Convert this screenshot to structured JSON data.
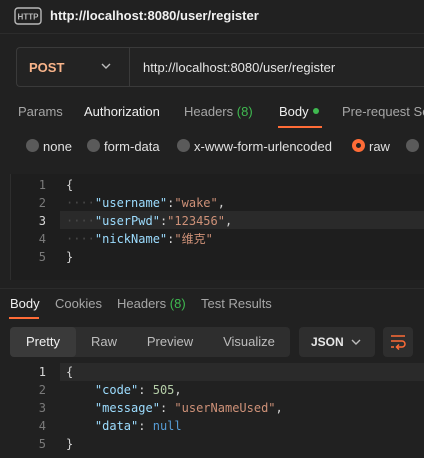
{
  "window": {
    "title": "http://localhost:8080/user/register",
    "icon": "http-icon"
  },
  "request": {
    "method": "POST",
    "url": "http://localhost:8080/user/register"
  },
  "request_tabs": [
    {
      "label": "Params"
    },
    {
      "label": "Authorization"
    },
    {
      "label": "Headers",
      "count": "(8)"
    },
    {
      "label": "Body",
      "active": true
    },
    {
      "label": "Pre-request Sc"
    }
  ],
  "body_types": [
    {
      "label": "none"
    },
    {
      "label": "form-data"
    },
    {
      "label": "x-www-form-urlencoded"
    },
    {
      "label": "raw",
      "selected": true
    }
  ],
  "request_body": {
    "line_numbers": [
      "1",
      "2",
      "3",
      "4",
      "5"
    ],
    "lines": [
      {
        "tokens": [
          {
            "t": "{",
            "c": "punc"
          }
        ]
      },
      {
        "tokens": [
          {
            "t": "\"username\"",
            "c": "key"
          },
          {
            "t": ":",
            "c": "punc"
          },
          {
            "t": "\"wake\"",
            "c": "str"
          },
          {
            "t": ",",
            "c": "punc"
          }
        ]
      },
      {
        "tokens": [
          {
            "t": "\"userPwd\"",
            "c": "key"
          },
          {
            "t": ":",
            "c": "punc"
          },
          {
            "t": "\"123456\"",
            "c": "str"
          },
          {
            "t": ",",
            "c": "punc"
          }
        ]
      },
      {
        "tokens": [
          {
            "t": "\"nickName\"",
            "c": "key"
          },
          {
            "t": ":",
            "c": "punc"
          },
          {
            "t": "\"维克\"",
            "c": "str"
          }
        ]
      },
      {
        "tokens": [
          {
            "t": "}",
            "c": "punc"
          }
        ]
      }
    ]
  },
  "response_tabs": [
    {
      "label": "Body",
      "active": true
    },
    {
      "label": "Cookies"
    },
    {
      "label": "Headers",
      "count": "(8)"
    },
    {
      "label": "Test Results"
    }
  ],
  "view_modes": [
    {
      "label": "Pretty",
      "active": true
    },
    {
      "label": "Raw"
    },
    {
      "label": "Preview"
    },
    {
      "label": "Visualize"
    }
  ],
  "format": "JSON",
  "wrap_icon": "wrap-lines-icon",
  "response_body": {
    "line_numbers": [
      "1",
      "2",
      "3",
      "4",
      "5"
    ],
    "lines": [
      {
        "tokens": [
          {
            "t": "{",
            "c": "punc"
          }
        ]
      },
      {
        "tokens": [
          {
            "t": "\"code\"",
            "c": "key"
          },
          {
            "t": ": ",
            "c": "punc"
          },
          {
            "t": "505",
            "c": "num"
          },
          {
            "t": ",",
            "c": "punc"
          }
        ]
      },
      {
        "tokens": [
          {
            "t": "\"message\"",
            "c": "key"
          },
          {
            "t": ": ",
            "c": "punc"
          },
          {
            "t": "\"userNameUsed\"",
            "c": "str"
          },
          {
            "t": ",",
            "c": "punc"
          }
        ]
      },
      {
        "tokens": [
          {
            "t": "\"data\"",
            "c": "key"
          },
          {
            "t": ": ",
            "c": "punc"
          },
          {
            "t": "null",
            "c": "kw"
          }
        ]
      },
      {
        "tokens": [
          {
            "t": "}",
            "c": "punc"
          }
        ]
      }
    ]
  },
  "colors": {
    "accent": "#ff6c37",
    "method": "#f9b48a",
    "count": "#3fb950",
    "background": "#212121"
  }
}
